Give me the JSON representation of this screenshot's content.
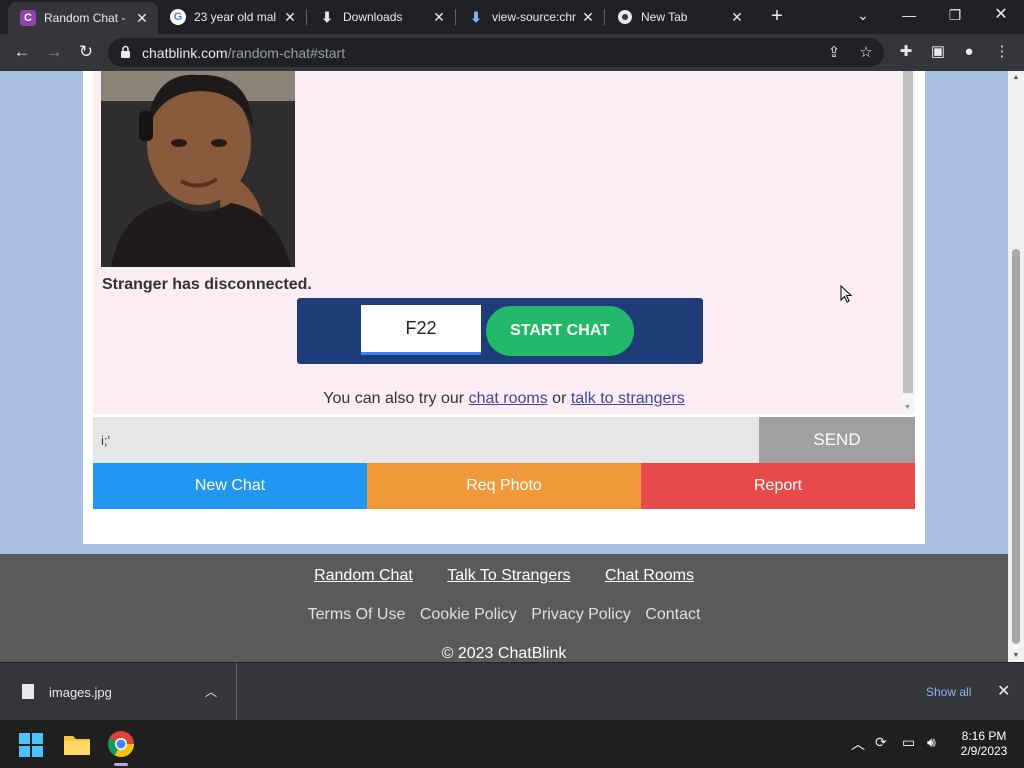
{
  "browser": {
    "tabs": [
      {
        "label": "Random Chat - ",
        "favicon": "chatblink-favicon",
        "active": true
      },
      {
        "label": "23 year old mal",
        "favicon": "google-favicon",
        "active": false
      },
      {
        "label": "Downloads",
        "favicon": "download-icon",
        "active": false
      },
      {
        "label": "view-source:chr",
        "favicon": "download-icon",
        "active": false
      },
      {
        "label": "New Tab",
        "favicon": "chrome-icon",
        "active": false
      }
    ],
    "url_domain": "chatblink.com",
    "url_path": "/random-chat#start"
  },
  "page": {
    "status_text": "Stranger has disconnected.",
    "code_value": "F22",
    "start_label": "START CHAT",
    "also_prefix": "You can also try our",
    "also_link1": "chat rooms",
    "also_or": "or",
    "also_link2": "talk to strangers",
    "message_value": "i;'",
    "send_label": "SEND",
    "actions": [
      "New Chat",
      "Req Photo",
      "Report"
    ],
    "action_colors": [
      "#2196f3",
      "#f0993a",
      "#e84a4a"
    ]
  },
  "footer": {
    "links_primary": [
      "Random Chat",
      "Talk To Strangers",
      "Chat Rooms"
    ],
    "links_secondary": [
      "Terms Of Use",
      "Cookie Policy",
      "Privacy Policy",
      "Contact"
    ],
    "copyright": "© 2023 ChatBlink"
  },
  "downloads": {
    "file_name": "images.jpg",
    "show_all": "Show all"
  },
  "taskbar": {
    "time": "8:16 PM",
    "date": "2/9/2023"
  }
}
